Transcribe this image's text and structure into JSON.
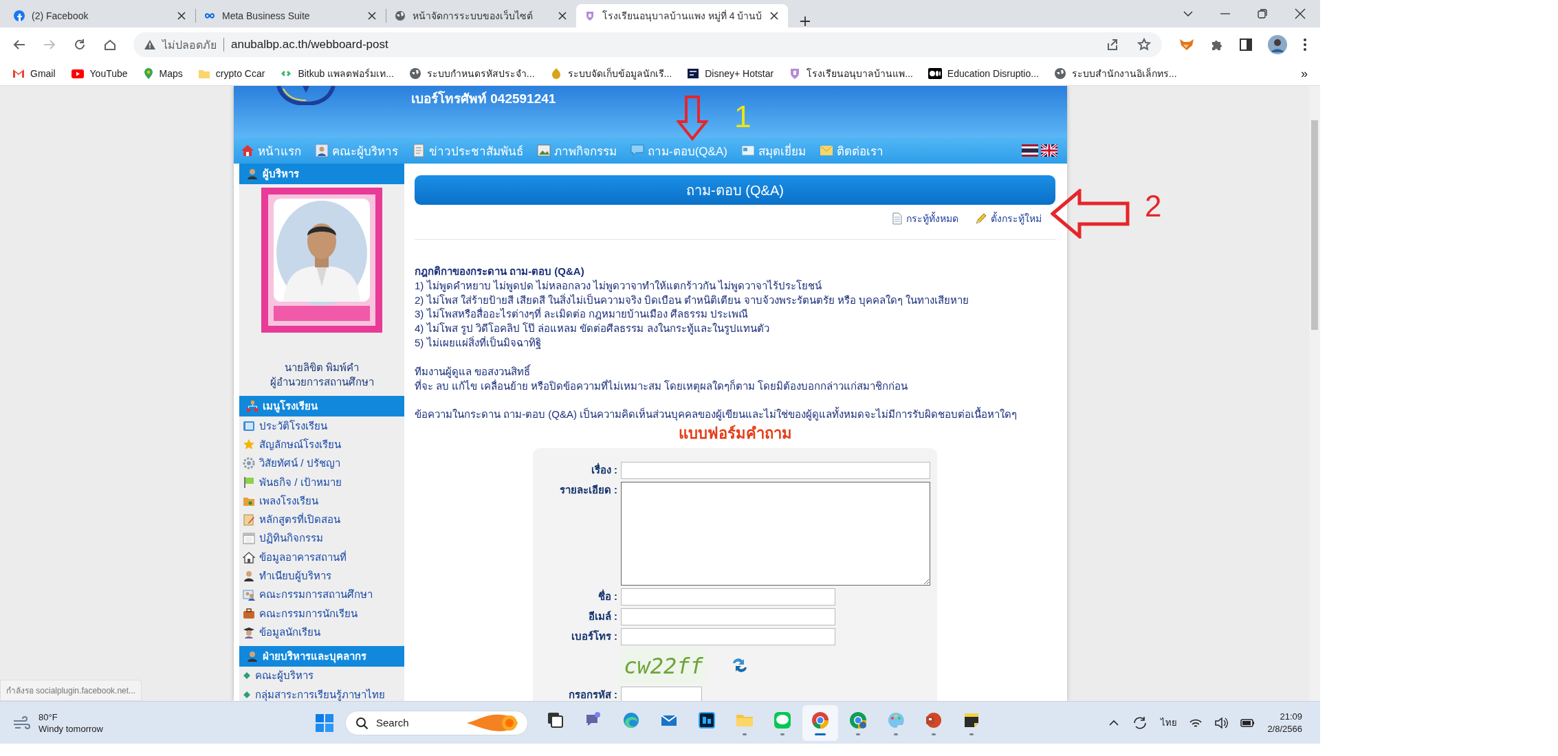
{
  "browser": {
    "tabs": [
      {
        "title": "(2) Facebook",
        "selected": false
      },
      {
        "title": "Meta Business Suite",
        "selected": false
      },
      {
        "title": "หน้าจัดการระบบของเว็บไซต์",
        "selected": false
      },
      {
        "title": "โรงเรียนอนุบาลบ้านแพง หมู่ที่ 4 บ้านบ้",
        "selected": true
      }
    ],
    "address": {
      "security": "ไม่ปลอดภัย",
      "url": "anubalbp.ac.th/webboard-post"
    },
    "bookmarks": [
      {
        "label": "Gmail"
      },
      {
        "label": "YouTube"
      },
      {
        "label": "Maps"
      },
      {
        "label": "crypto Ccar"
      },
      {
        "label": "Bitkub แพลตฟอร์มเท..."
      },
      {
        "label": "ระบบกำหนดรหัสประจำ..."
      },
      {
        "label": "ระบบจัดเก็บข้อมูลนักเรี..."
      },
      {
        "label": "Disney+ Hotstar"
      },
      {
        "label": "โรงเรียนอนุบาลบ้านแพ..."
      },
      {
        "label": "Education Disruptio..."
      },
      {
        "label": "ระบบสำนักงานอิเล็กทร..."
      }
    ],
    "bookmarks_more": "»"
  },
  "site": {
    "phone": "เบอร์โทรศัพท์ 042591241",
    "nav": [
      {
        "label": "หน้าแรก"
      },
      {
        "label": "คณะผู้บริหาร"
      },
      {
        "label": "ข่าวประชาสัมพันธ์"
      },
      {
        "label": "ภาพกิจกรรม"
      },
      {
        "label": "ถาม-ตอบ(Q&A)"
      },
      {
        "label": "สมุดเยี่ยม"
      },
      {
        "label": "ติดต่อเรา"
      }
    ],
    "sidebar": {
      "admin_heading": "ผู้บริหาร",
      "director_name": "นายลิขิต พิมพ์คำ",
      "director_title": "ผู้อำนวยการสถานศึกษา",
      "menu_heading": "เมนูโรงเรียน",
      "menu": [
        {
          "label": "ประวัติโรงเรียน"
        },
        {
          "label": "สัญลักษณ์โรงเรียน"
        },
        {
          "label": "วิสัยทัศน์ / ปรัชญา"
        },
        {
          "label": "พันธกิจ / เป้าหมาย"
        },
        {
          "label": "เพลงโรงเรียน"
        },
        {
          "label": "หลักสูตรที่เปิดสอน"
        },
        {
          "label": "ปฏิทินกิจกรรม"
        },
        {
          "label": "ข้อมูลอาคารสถานที่"
        },
        {
          "label": "ทำเนียบผู้บริหาร"
        },
        {
          "label": "คณะกรรมการสถานศึกษา"
        },
        {
          "label": "คณะกรรมการนักเรียน"
        },
        {
          "label": "ข้อมูลนักเรียน"
        }
      ],
      "staff_heading": "ฝ่ายบริหารและบุคลากร",
      "staff": [
        {
          "label": "คณะผู้บริหาร"
        },
        {
          "label": "กลุ่มสาระการเรียนรู้ภาษาไทย"
        }
      ]
    },
    "main": {
      "title": "ถาม-ตอบ (Q&A)",
      "links": [
        {
          "label": "กระทู้ทั้งหมด"
        },
        {
          "label": "ตั้งกระทู้ใหม่"
        }
      ],
      "rules_heading": "กฎกติกาของกระดาน ถาม-ตอบ (Q&A)",
      "rules": [
        "1) ไม่พูดคำหยาบ ไม่พูดปด ไม่หลอกลวง ไม่พูดวาจาทำให้แตกร้าวกัน ไม่พูดวาจาไร้ประโยชน์",
        "2) ไม่โพส ใส่ร้ายป้ายสี เสียดสี ในสิ่งไม่เป็นความจริง บิดเบือน ตำหนิติเตียน จาบจ้วงพระรัตนตรัย หรือ บุคคลใดๆ ในทางเสียหาย",
        "3) ไม่โพสหรือสื่ออะไรต่างๆที่ ละเมิดต่อ กฎหมายบ้านเมือง ศีลธรรม ประเพณี",
        "4) ไม่โพส รูป วิดีโอคลิป โป๊ ล่อแหลม ขัดต่อศีลธรรม ลงในกระทู้และในรูปแทนตัว",
        "5) ไม่เผยแผ่สิ่งที่เป็นมิจฉาทิฐิ"
      ],
      "team_notice": [
        "ทีมงานผู้ดูแล ขอสงวนสิทธิ์",
        "ที่จะ ลบ แก้ไข เคลื่อนย้าย หรือปิดข้อความที่ไม่เหมาะสม โดยเหตุผลใดๆก็ตาม โดยมิต้องบอกกล่าวแก่สมาชิกก่อน"
      ],
      "disclaimer": "ข้อความในกระดาน ถาม-ตอบ (Q&A) เป็นความคิดเห็นส่วนบุคคลของผู้เขียนและไม่ใช่ของผู้ดูแลทั้งหมดจะไม่มีการรับผิดชอบต่อเนื้อหาใดๆ",
      "form": {
        "title": "แบบฟอร์มคำถาม",
        "fields": [
          {
            "kind": "line",
            "label": "เรื่อง :"
          },
          {
            "kind": "area",
            "label": "รายละเอียด :"
          },
          {
            "kind": "short",
            "label": "ชื่อ :"
          },
          {
            "kind": "short",
            "label": "อีเมล์ :"
          },
          {
            "kind": "short",
            "label": "เบอร์โทร :"
          },
          {
            "kind": "captcha",
            "code": "cw22ff"
          },
          {
            "kind": "code",
            "label": "กรอกรหัส :"
          }
        ]
      }
    }
  },
  "status_bubble": "กำลังรอ socialplugin.facebook.net...",
  "annotations": [
    {
      "label": "1"
    },
    {
      "label": "2"
    }
  ],
  "taskbar": {
    "temperature": "80°F",
    "forecast": "Windy tomorrow",
    "search_placeholder": "Search",
    "apps": [
      {
        "running": false,
        "selected": false
      },
      {
        "running": false,
        "selected": false
      },
      {
        "running": false,
        "selected": false
      },
      {
        "running": false,
        "selected": false
      },
      {
        "running": false,
        "selected": false
      },
      {
        "running": true,
        "selected": false
      },
      {
        "running": true,
        "selected": false
      },
      {
        "running": true,
        "selected": true
      },
      {
        "running": true,
        "selected": false
      },
      {
        "running": true,
        "selected": false
      },
      {
        "running": true,
        "selected": false
      },
      {
        "running": true,
        "selected": false
      }
    ],
    "language": "ไทย",
    "time": "21:09",
    "date": "2/8/2566"
  }
}
